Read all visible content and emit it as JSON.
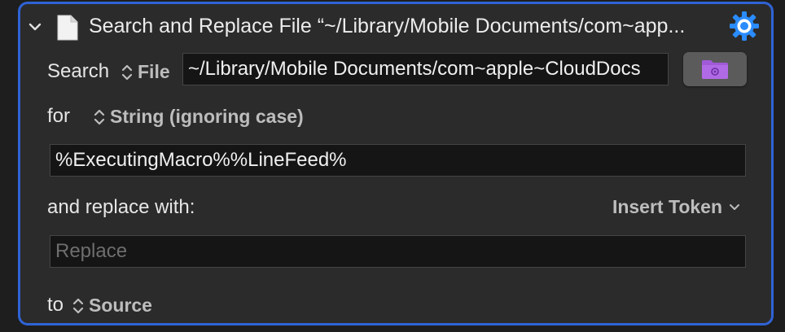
{
  "header": {
    "title": "Search and Replace File “~/Library/Mobile Documents/com~app...",
    "collapse_icon": "chevron-down-icon",
    "file_icon": "document-icon",
    "gear_icon": "gear-icon"
  },
  "search_row": {
    "label": "Search",
    "source_type": "File",
    "path_value": "~/Library/Mobile Documents/com~apple~CloudDocs",
    "folder_button_icon": "folder-gear-icon"
  },
  "for_row": {
    "label": "for",
    "match_type": "String (ignoring case)"
  },
  "search_field": {
    "value": "%ExecutingMacro%%LineFeed%"
  },
  "replace_row": {
    "label": "and replace with:",
    "insert_token_label": "Insert Token"
  },
  "replace_field": {
    "value": "",
    "placeholder": "Replace"
  },
  "to_row": {
    "label": "to",
    "destination": "Source"
  },
  "colors": {
    "accent_border": "#2f63d6",
    "panel_bg": "#2b2b2b",
    "folder_icon": "#a05ad8"
  }
}
